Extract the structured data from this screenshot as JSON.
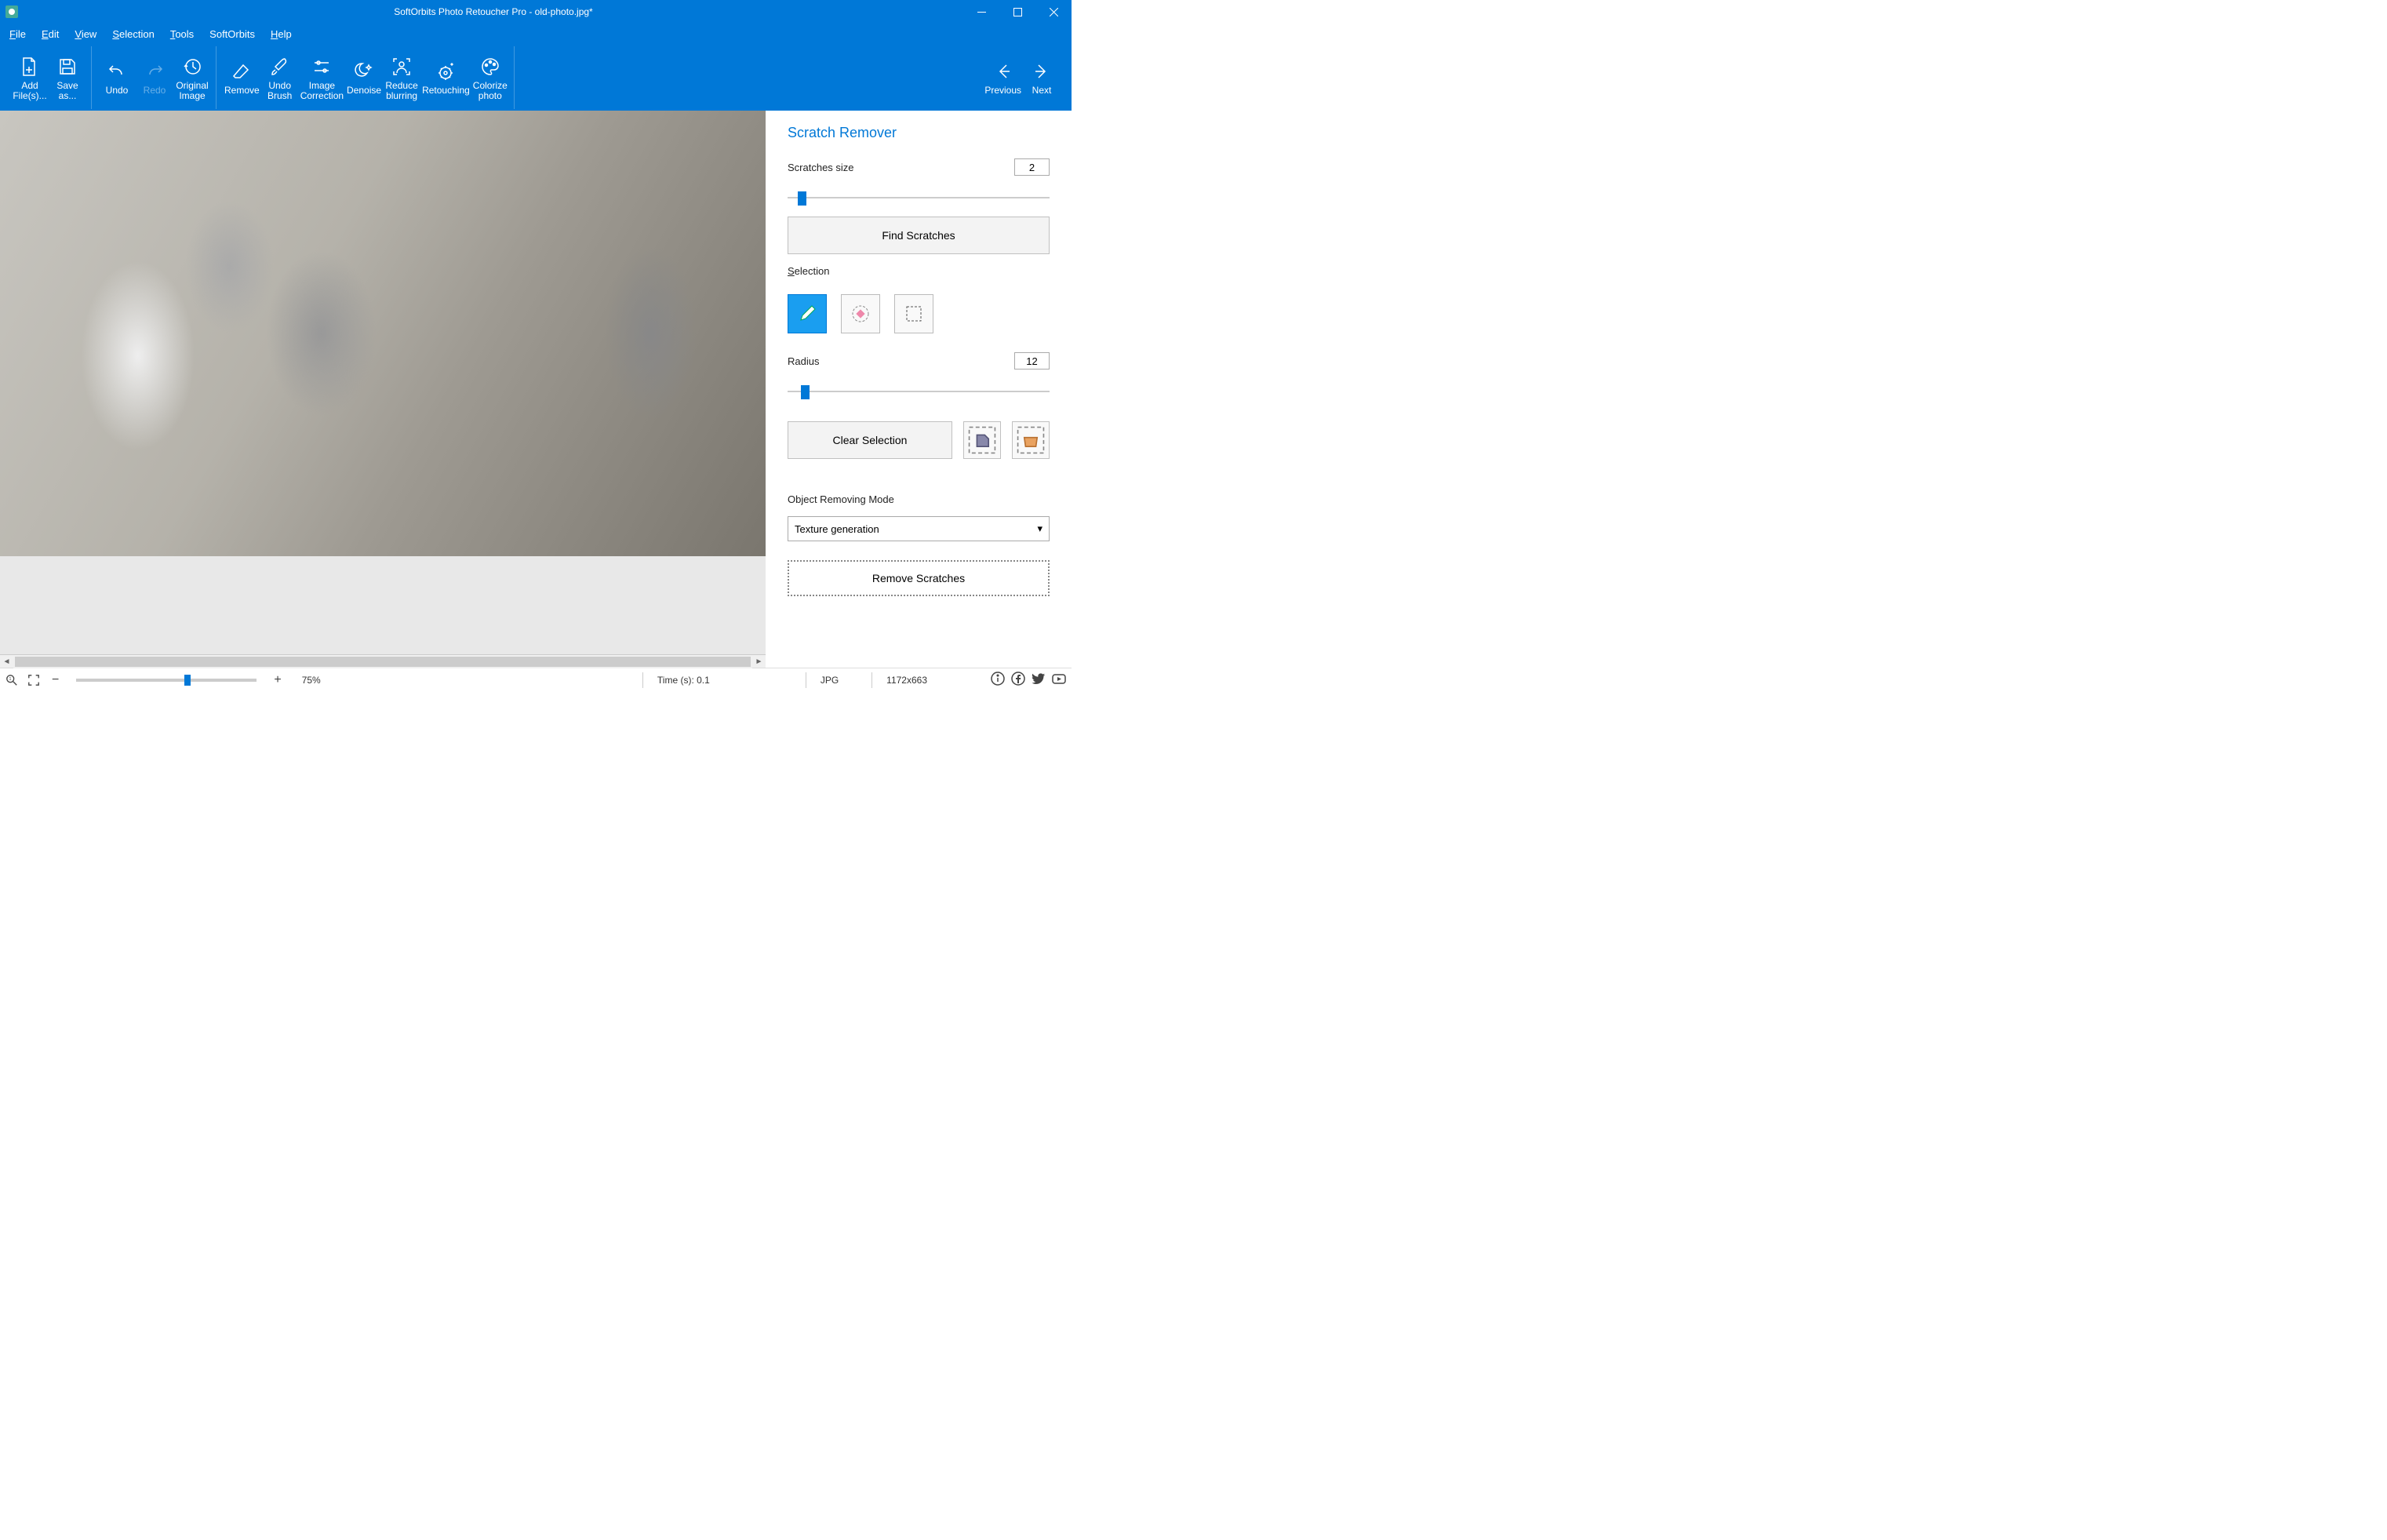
{
  "titlebar": {
    "title": "SoftOrbits Photo Retoucher Pro - old-photo.jpg*"
  },
  "menu": {
    "items": [
      "File",
      "Edit",
      "View",
      "Selection",
      "Tools",
      "SoftOrbits",
      "Help"
    ]
  },
  "toolbar": {
    "add_files": "Add\nFile(s)...",
    "save_as": "Save\nas...",
    "undo": "Undo",
    "redo": "Redo",
    "original_image": "Original\nImage",
    "remove": "Remove",
    "undo_brush": "Undo\nBrush",
    "image_correction": "Image\nCorrection",
    "denoise": "Denoise",
    "reduce_blurring": "Reduce\nblurring",
    "retouching": "Retouching",
    "colorize_photo": "Colorize\nphoto",
    "previous": "Previous",
    "next": "Next"
  },
  "panel": {
    "title": "Scratch Remover",
    "scratches_size_label": "Scratches size",
    "scratches_size_value": "2",
    "find_scratches": "Find Scratches",
    "selection_label": "Selection",
    "radius_label": "Radius",
    "radius_value": "12",
    "clear_selection": "Clear Selection",
    "object_mode_label": "Object Removing Mode",
    "object_mode_value": "Texture generation",
    "remove_scratches": "Remove Scratches"
  },
  "status": {
    "zoom": "75%",
    "time": "Time (s): 0.1",
    "format": "JPG",
    "dimensions": "1172x663"
  }
}
